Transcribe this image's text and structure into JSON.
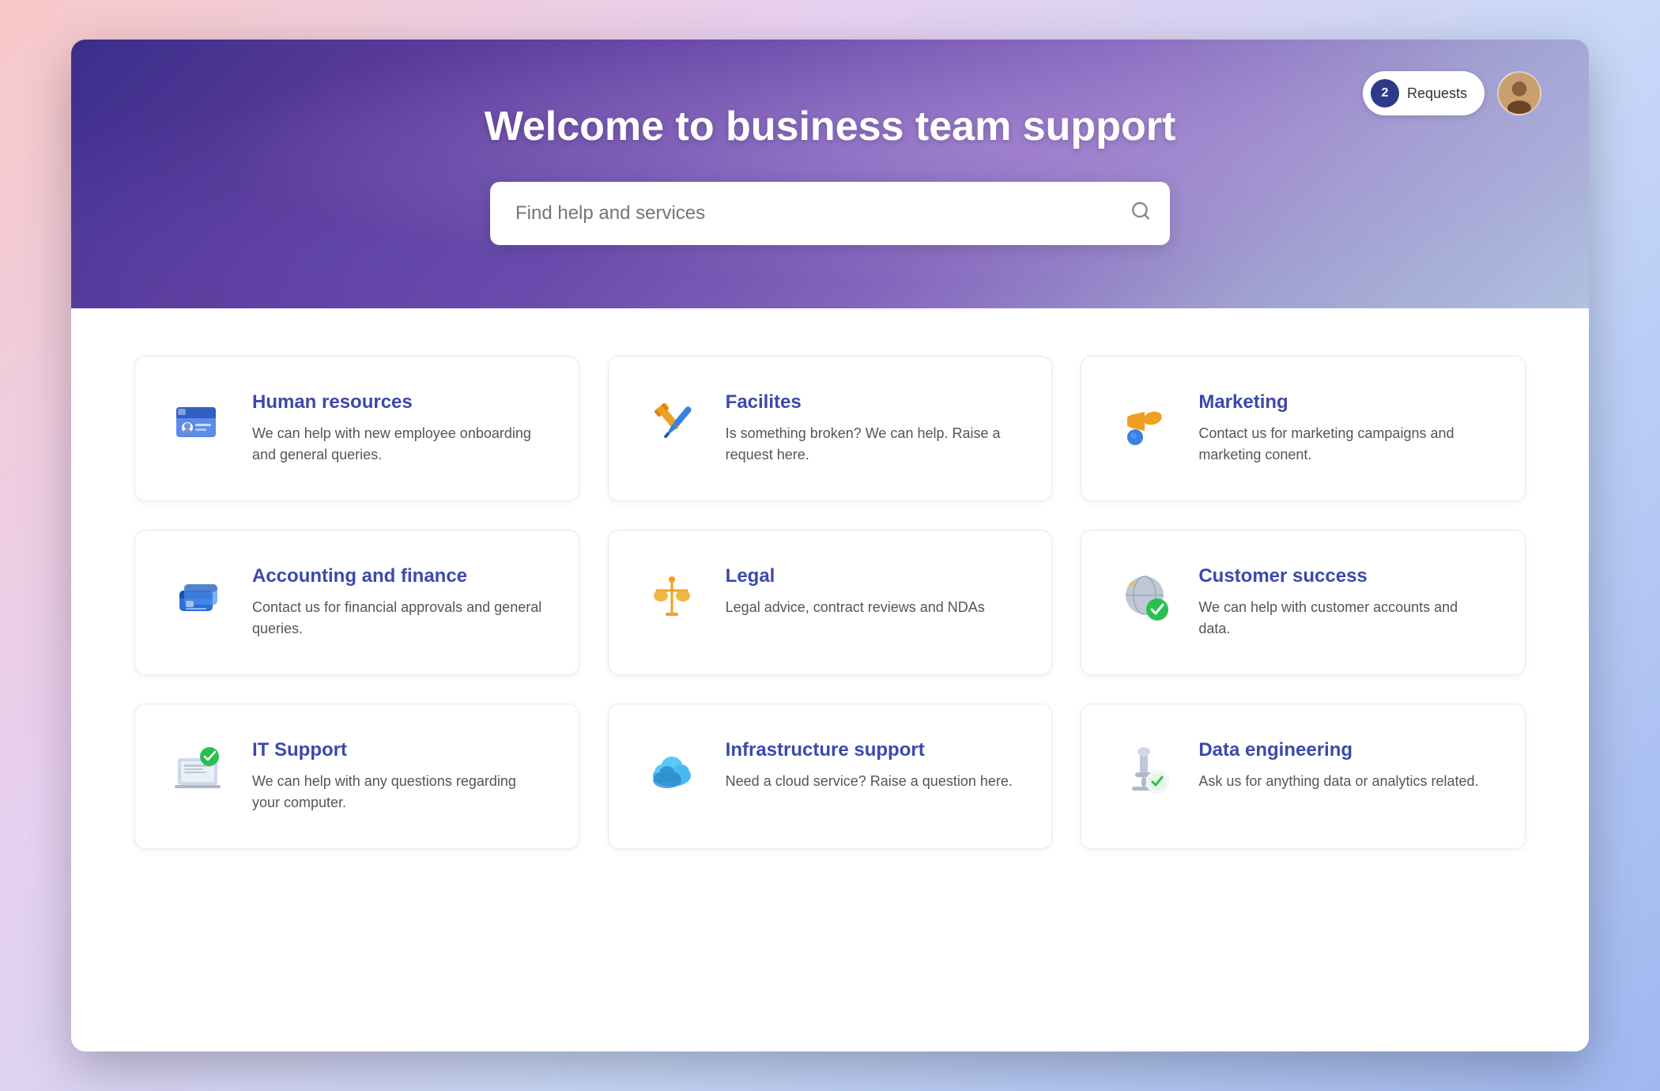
{
  "header": {
    "title": "Welcome to business team support",
    "search_placeholder": "Find help and services",
    "requests_count": "2",
    "requests_label": "Requests"
  },
  "cards": [
    {
      "id": "human-resources",
      "title": "Human resources",
      "description": "We can help with new employee onboarding and general queries.",
      "icon": "hr"
    },
    {
      "id": "facilities",
      "title": "Facilites",
      "description": "Is something broken? We can help. Raise a request here.",
      "icon": "facilities"
    },
    {
      "id": "marketing",
      "title": "Marketing",
      "description": "Contact us for marketing campaigns and marketing conent.",
      "icon": "marketing"
    },
    {
      "id": "accounting-finance",
      "title": "Accounting and finance",
      "description": "Contact us for financial approvals and general queries.",
      "icon": "accounting"
    },
    {
      "id": "legal",
      "title": "Legal",
      "description": "Legal advice, contract reviews and NDAs",
      "icon": "legal"
    },
    {
      "id": "customer-success",
      "title": "Customer success",
      "description": "We can help with customer accounts and data.",
      "icon": "customer-success"
    },
    {
      "id": "it-support",
      "title": "IT Support",
      "description": "We can help with any questions regarding your computer.",
      "icon": "it-support"
    },
    {
      "id": "infrastructure-support",
      "title": "Infrastructure support",
      "description": "Need a cloud service? Raise a question here.",
      "icon": "infrastructure"
    },
    {
      "id": "data-engineering",
      "title": "Data engineering",
      "description": "Ask us for anything data or analytics related.",
      "icon": "data-engineering"
    }
  ]
}
